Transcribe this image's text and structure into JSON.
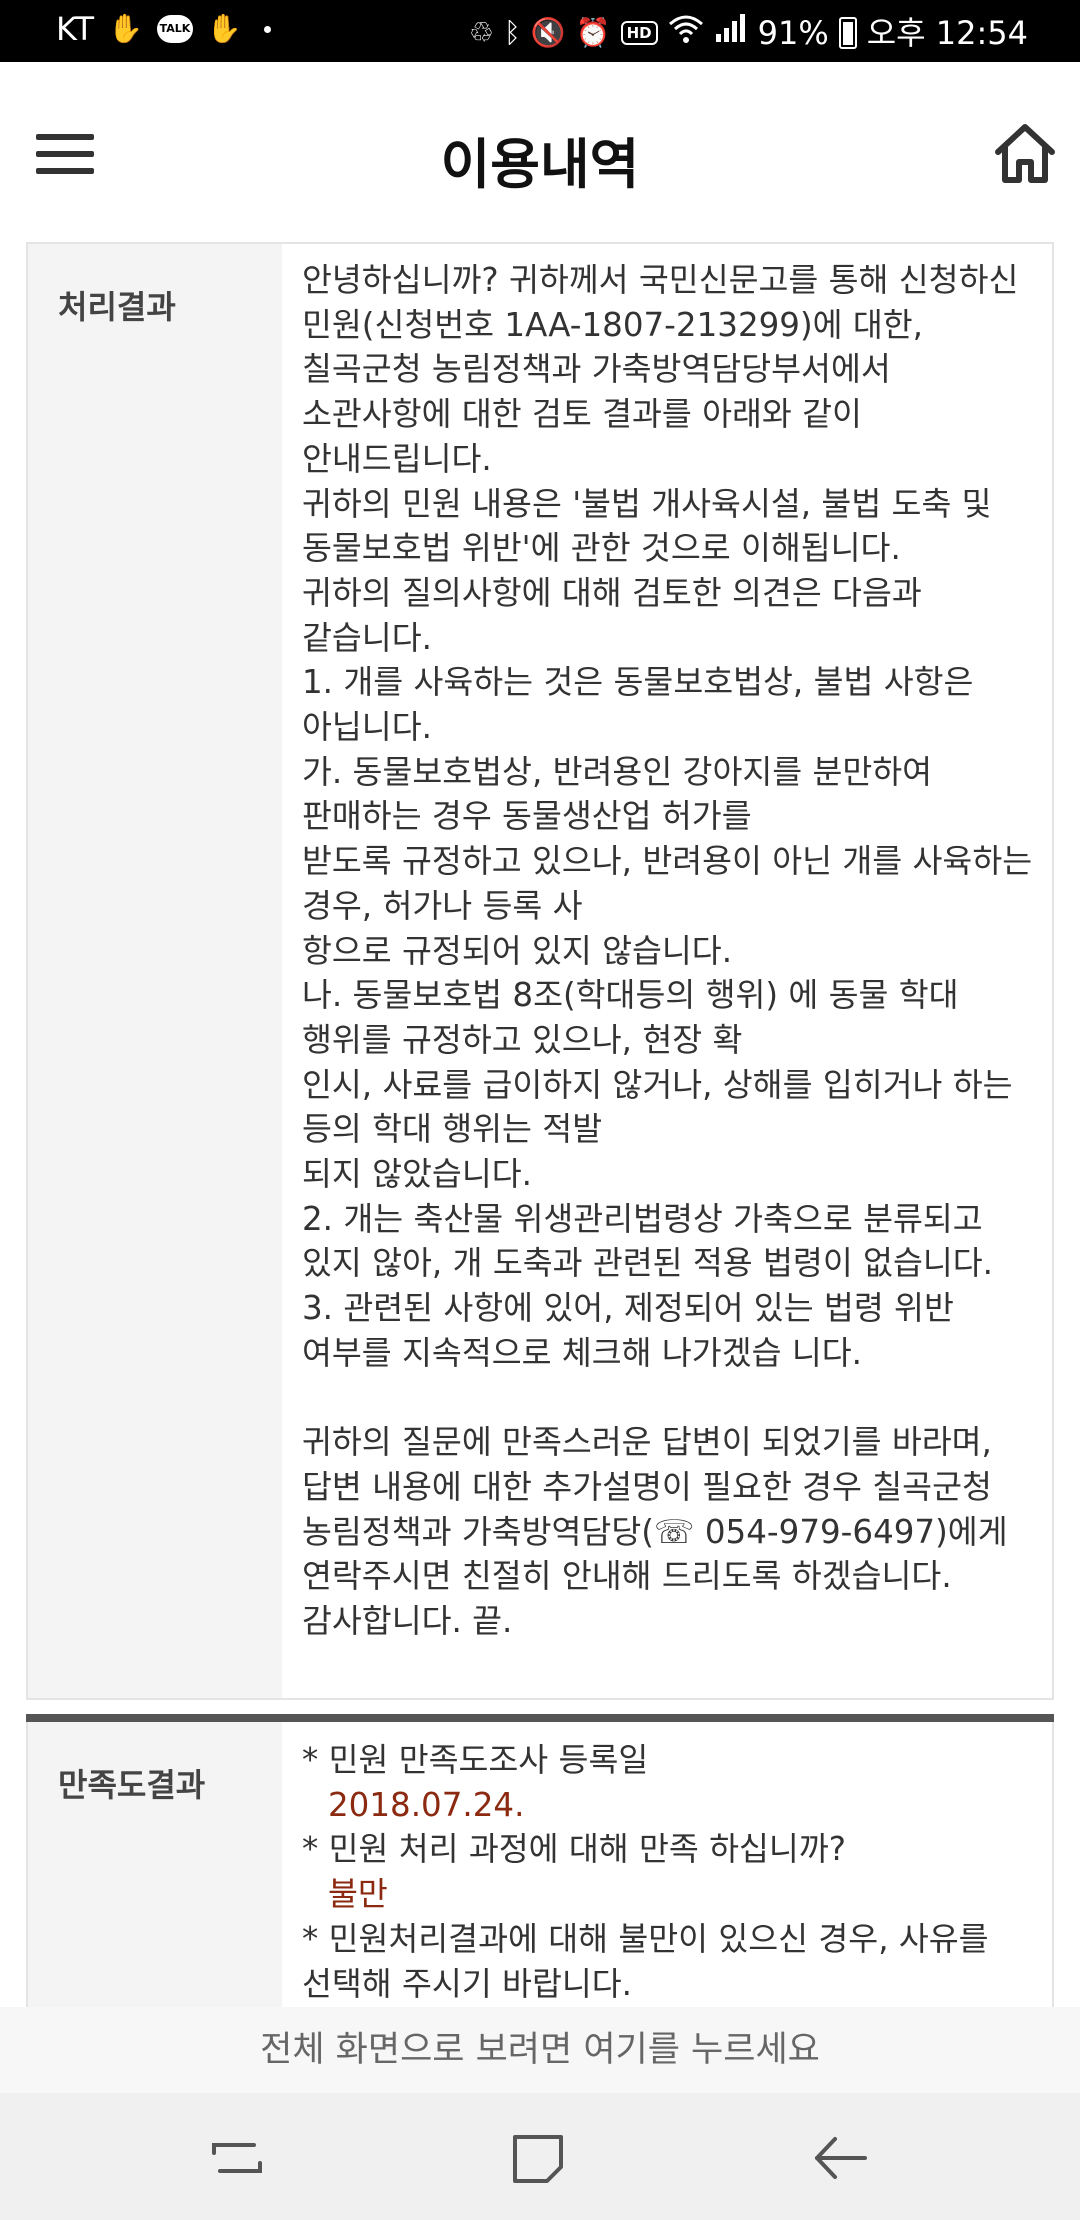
{
  "status_bar": {
    "carrier": "KT",
    "battery": "91%",
    "time": "오후 12:54",
    "talk_label": "TALK",
    "hd_label": "HD",
    "left_icons": [
      "hand-notification-icon",
      "kakaotalk-icon",
      "hand-notification-icon",
      "dot-icon"
    ],
    "right_icons": [
      "data-saver-icon",
      "bluetooth-icon",
      "mute-icon",
      "alarm-icon",
      "hd-voice-icon",
      "wifi-icon",
      "signal-icon",
      "battery-icon"
    ]
  },
  "header": {
    "title": "이용내역",
    "menu_icon": "hamburger-menu-icon",
    "home_icon": "home-icon"
  },
  "result": {
    "label": "처리결과",
    "text": "안녕하십니까? 귀하께서 국민신문고를 통해 신청하신 민원(신청번호 1AA-1807-213299)에 대한, 칠곡군청 농림정책과 가축방역담당부서에서 소관사항에 대한 검토 결과를 아래와 같이 안내드립니다.\n귀하의 민원 내용은 '불법 개사육시설, 불법 도축 및 동물보호법 위반'에 관한 것으로 이해됩니다.\n귀하의 질의사항에 대해 검토한 의견은 다음과 같습니다.\n1. 개를 사육하는 것은 동물보호법상, 불법 사항은 아닙니다.\n가. 동물보호법상, 반려용인 강아지를 분만하여 판매하는 경우 동물생산업 허가를\n받도록 규정하고 있으나, 반려용이 아닌 개를 사육하는 경우, 허가나 등록 사\n항으로 규정되어 있지 않습니다.\n나. 동물보호법 8조(학대등의 행위) 에 동물 학대 행위를 규정하고 있으나, 현장 확\n인시, 사료를 급이하지 않거나, 상해를 입히거나 하는 등의 학대 행위는 적발\n되지 않았습니다.\n2. 개는 축산물 위생관리법령상 가축으로 분류되고 있지 않아, 개 도축과 관련된 적용 법령이 없습니다.\n3. 관련된 사항에 있어, 제정되어 있는 법령 위반 여부를 지속적으로 체크해 나가겠습 니다.\n\n귀하의 질문에 만족스러운 답변이 되었기를 바라며, 답변 내용에 대한 추가설명이 필요한 경우 칠곡군청 농림정책과 가축방역담당(☏ 054-979-6497)에게 연락주시면 친절히 안내해 드리도록 하겠습니다. 감사합니다. 끝."
  },
  "satisfaction": {
    "label": "만족도결과",
    "items": [
      {
        "question": "* 민원 만족도조사 등록일",
        "answer": "2018.07.24."
      },
      {
        "question": "* 민원 처리 과정에 대해 만족 하십니까?",
        "answer": "불만"
      },
      {
        "question": "* 민원처리결과에 대해 불만이 있으신 경우, 사유를 선택해 주시기 바랍니다.",
        "answer": ""
      }
    ],
    "answer_color": "#8b2a10"
  },
  "fullscreen_prompt": "전체 화면으로 보려면 여기를 누르세요",
  "nav_bar": {
    "buttons": [
      "recent-apps-icon",
      "home-square-icon",
      "back-arrow-icon"
    ]
  }
}
